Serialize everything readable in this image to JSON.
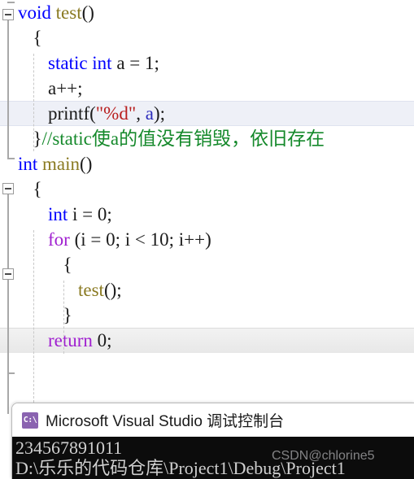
{
  "editor": {
    "language": "c",
    "lines": [
      {
        "id": "line-void-test",
        "indent": 0,
        "tokens": [
          {
            "t": "void",
            "c": "kw"
          },
          {
            "t": " ",
            "c": "pln"
          },
          {
            "t": "test",
            "c": "fn"
          },
          {
            "t": "()",
            "c": "punc"
          }
        ],
        "fold": "open"
      },
      {
        "id": "line-open-brace-1",
        "indent": 1,
        "tokens": [
          {
            "t": "{",
            "c": "punc"
          }
        ]
      },
      {
        "id": "line-static-int-a",
        "indent": 2,
        "tokens": [
          {
            "t": "static",
            "c": "kw"
          },
          {
            "t": " ",
            "c": "pln"
          },
          {
            "t": "int",
            "c": "kw"
          },
          {
            "t": " a = ",
            "c": "pln"
          },
          {
            "t": "1",
            "c": "num"
          },
          {
            "t": ";",
            "c": "punc"
          }
        ]
      },
      {
        "id": "line-a-increment",
        "indent": 2,
        "tokens": [
          {
            "t": "a++;",
            "c": "pln"
          }
        ]
      },
      {
        "id": "line-printf",
        "indent": 2,
        "tokens": [
          {
            "t": "printf",
            "c": "pln"
          },
          {
            "t": "(",
            "c": "punc"
          },
          {
            "t": "\"%d\"",
            "c": "str"
          },
          {
            "t": ", ",
            "c": "pln"
          },
          {
            "t": "a",
            "c": "var"
          },
          {
            "t": ");",
            "c": "punc"
          }
        ],
        "highlight": true
      },
      {
        "id": "line-close-comment",
        "indent": 1,
        "tokens": [
          {
            "t": "}",
            "c": "punc"
          },
          {
            "t": "//static使a的值没有销毁，依旧存在",
            "c": "cmt"
          }
        ]
      },
      {
        "id": "line-int-main",
        "indent": 0,
        "tokens": [
          {
            "t": "int",
            "c": "kw"
          },
          {
            "t": " ",
            "c": "pln"
          },
          {
            "t": "main",
            "c": "fn"
          },
          {
            "t": "()",
            "c": "punc"
          }
        ],
        "fold": "open"
      },
      {
        "id": "line-open-brace-2",
        "indent": 1,
        "tokens": [
          {
            "t": "{",
            "c": "punc"
          }
        ]
      },
      {
        "id": "line-int-i",
        "indent": 2,
        "tokens": [
          {
            "t": "int",
            "c": "kw"
          },
          {
            "t": " i = ",
            "c": "pln"
          },
          {
            "t": "0",
            "c": "num"
          },
          {
            "t": ";",
            "c": "punc"
          }
        ]
      },
      {
        "id": "line-for-loop",
        "indent": 2,
        "tokens": [
          {
            "t": "for",
            "c": "kw2"
          },
          {
            "t": " (i = ",
            "c": "pln"
          },
          {
            "t": "0",
            "c": "num"
          },
          {
            "t": "; i < ",
            "c": "pln"
          },
          {
            "t": "10",
            "c": "num"
          },
          {
            "t": "; i++)",
            "c": "pln"
          }
        ],
        "fold": "open"
      },
      {
        "id": "line-open-brace-3",
        "indent": 3,
        "tokens": [
          {
            "t": "{",
            "c": "punc"
          }
        ]
      },
      {
        "id": "line-test-call",
        "indent": 4,
        "tokens": [
          {
            "t": "test",
            "c": "fn"
          },
          {
            "t": "();",
            "c": "punc"
          }
        ]
      },
      {
        "id": "line-close-brace-3",
        "indent": 3,
        "tokens": [
          {
            "t": "}",
            "c": "punc"
          }
        ]
      },
      {
        "id": "line-return-zero",
        "indent": 2,
        "tokens": [
          {
            "t": "return",
            "c": "kw2"
          },
          {
            "t": " ",
            "c": "pln"
          },
          {
            "t": "0",
            "c": "num"
          },
          {
            "t": ";",
            "c": "punc"
          }
        ],
        "highlight2": true
      }
    ]
  },
  "console": {
    "icon": "console-cmd-icon",
    "icon_glyph": "C:\\",
    "title": "Microsoft Visual Studio 调试控制台",
    "output_lines": [
      "234567891011",
      "D:\\乐乐的代码仓库\\Project1\\Debug\\Project1"
    ]
  },
  "watermark": {
    "text": "CSDN@chlorine5"
  },
  "colors": {
    "keyword_blue": "#0000ff",
    "keyword_purple": "#a020d0",
    "function_olive": "#8a7a22",
    "string_red": "#b81e1e",
    "comment_green": "#15892b",
    "highlight_bg": "#eef0f7",
    "console_bg": "#0c0c0c",
    "console_icon_purple": "#8a63b0"
  }
}
